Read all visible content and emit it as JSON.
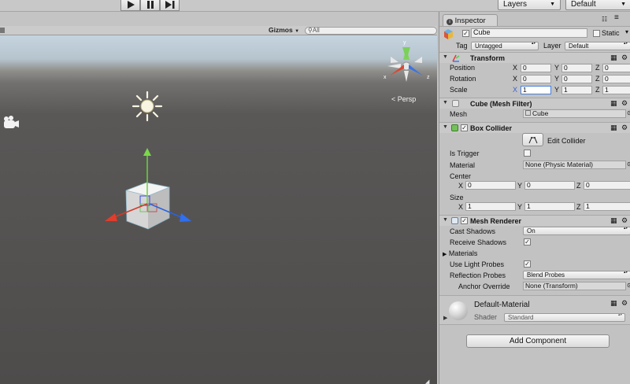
{
  "toolbar": {
    "play_icon": "play-icon",
    "pause_icon": "pause-icon",
    "step_icon": "step-icon",
    "layers_label": "Layers",
    "layout_label": "Default"
  },
  "scene": {
    "gizmos_label": "Gizmos",
    "search_placeholder": "All",
    "persp_label": "Persp"
  },
  "inspector": {
    "tab_label": "Inspector",
    "object": {
      "name": "Cube",
      "static_label": "Static",
      "tag_label": "Tag",
      "tag_value": "Untagged",
      "layer_label": "Layer",
      "layer_value": "Default"
    },
    "transform": {
      "title": "Transform",
      "position_label": "Position",
      "rotation_label": "Rotation",
      "scale_label": "Scale",
      "x": "X",
      "y": "Y",
      "z": "Z",
      "position": [
        "0",
        "0",
        "0"
      ],
      "rotation": [
        "0",
        "0",
        "0"
      ],
      "scale": [
        "1",
        "1",
        "1"
      ]
    },
    "mesh_filter": {
      "title": "Cube (Mesh Filter)",
      "mesh_label": "Mesh",
      "mesh_value": "Cube"
    },
    "box_collider": {
      "title": "Box Collider",
      "edit_label": "Edit Collider",
      "is_trigger_label": "Is Trigger",
      "material_label": "Material",
      "material_value": "None (Physic Material)",
      "center_label": "Center",
      "center": [
        "0",
        "0",
        "0"
      ],
      "size_label": "Size",
      "size": [
        "1",
        "1",
        "1"
      ]
    },
    "mesh_renderer": {
      "title": "Mesh Renderer",
      "cast_shadows_label": "Cast Shadows",
      "cast_shadows_value": "On",
      "receive_shadows_label": "Receive Shadows",
      "materials_label": "Materials",
      "light_probes_label": "Use Light Probes",
      "reflection_probes_label": "Reflection Probes",
      "reflection_probes_value": "Blend Probes",
      "anchor_override_label": "Anchor Override",
      "anchor_override_value": "None (Transform)"
    },
    "material": {
      "name": "Default-Material",
      "shader_label": "Shader",
      "shader_value": "Standard"
    },
    "add_component_label": "Add Component"
  }
}
